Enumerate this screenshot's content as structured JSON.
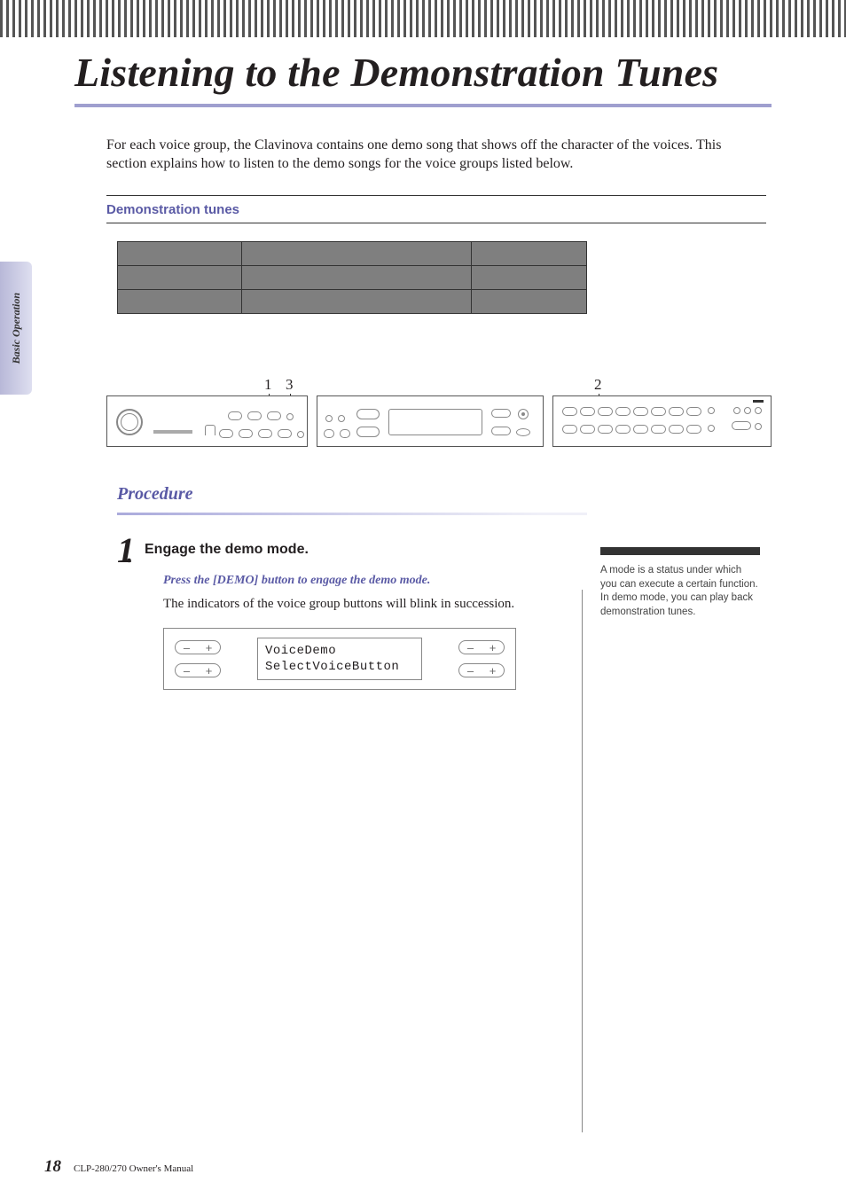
{
  "title": "Listening to the Demonstration Tunes",
  "intro": "For each voice group, the Clavinova contains one demo song that shows off the character of the voices. This section explains how to listen to the demo songs for the voice groups listed below.",
  "section_heading": "Demonstration tunes",
  "side_tab": "Basic Operation",
  "panel_refs": {
    "one": "1",
    "three": "3",
    "two": "2"
  },
  "procedure_heading": "Procedure",
  "step1": {
    "num": "1",
    "dot": ".",
    "title": "Engage the demo mode.",
    "instruction": "Press the [DEMO] button to engage the demo mode.",
    "body": "The indicators of the voice group buttons will blink in succession."
  },
  "lcd": {
    "line1": "VoiceDemo",
    "line2": "SelectVoiceButton"
  },
  "pm": {
    "minus": "–",
    "plus": "+"
  },
  "note": "A mode is a status under which you can execute a certain function. In demo mode, you can play back demonstration tunes.",
  "footer": {
    "page": "18",
    "manual": "CLP-280/270 Owner's Manual"
  }
}
